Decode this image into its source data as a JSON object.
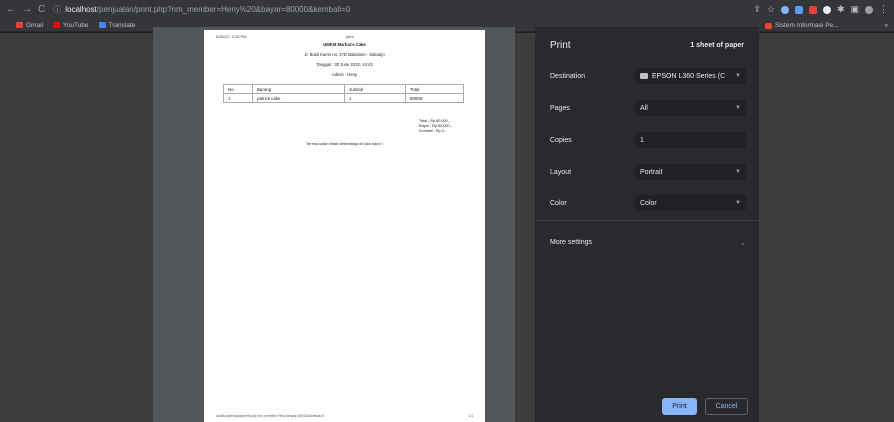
{
  "browser": {
    "url_host": "localhost",
    "url_path": "/penjualan/print.php?nm_member=Heny%20&bayar=80000&kembali=0",
    "bookmarks": [
      {
        "label": "Gmail"
      },
      {
        "label": "YouTube"
      },
      {
        "label": "Translate"
      }
    ],
    "bookmark_right": "Sistem Informasi Pe...",
    "more": "»"
  },
  "paper": {
    "date": "6/30/22, 2:16 PM",
    "doc_title": "print",
    "store": "UMKM Marfua's Cake",
    "address": "Jl. Bukit Karmi no. 27D Bukalono - Sidoarjo",
    "date_line": "Tanggal : 30 June 2022, 14:43",
    "admin": "Admin : Heny",
    "table": {
      "headers": [
        "No.",
        "Barang",
        "Jumlah",
        "Total"
      ],
      "rows": [
        [
          "1",
          "patrick cake",
          "1",
          "80000"
        ]
      ]
    },
    "total": "Total : Rp.80.000,-",
    "bayar": "Bayar : Rp.80.000,-",
    "kembali": "Kembali : Rp.0,-",
    "thanks": "Terima kasih telah berbelanja di toko kami !",
    "footer_url": "localhost/penjualan/print.php?nm_member=Heny &bayar=80000&kembali=0",
    "footer_page": "1/1"
  },
  "panel": {
    "title": "Print",
    "sheets": "1 sheet of paper",
    "destination_label": "Destination",
    "destination_value": "EPSON L360 Series (C",
    "pages_label": "Pages",
    "pages_value": "All",
    "copies_label": "Copies",
    "copies_value": "1",
    "layout_label": "Layout",
    "layout_value": "Portrait",
    "color_label": "Color",
    "color_value": "Color",
    "more_settings": "More settings",
    "print_button": "Print",
    "cancel_button": "Cancel"
  }
}
